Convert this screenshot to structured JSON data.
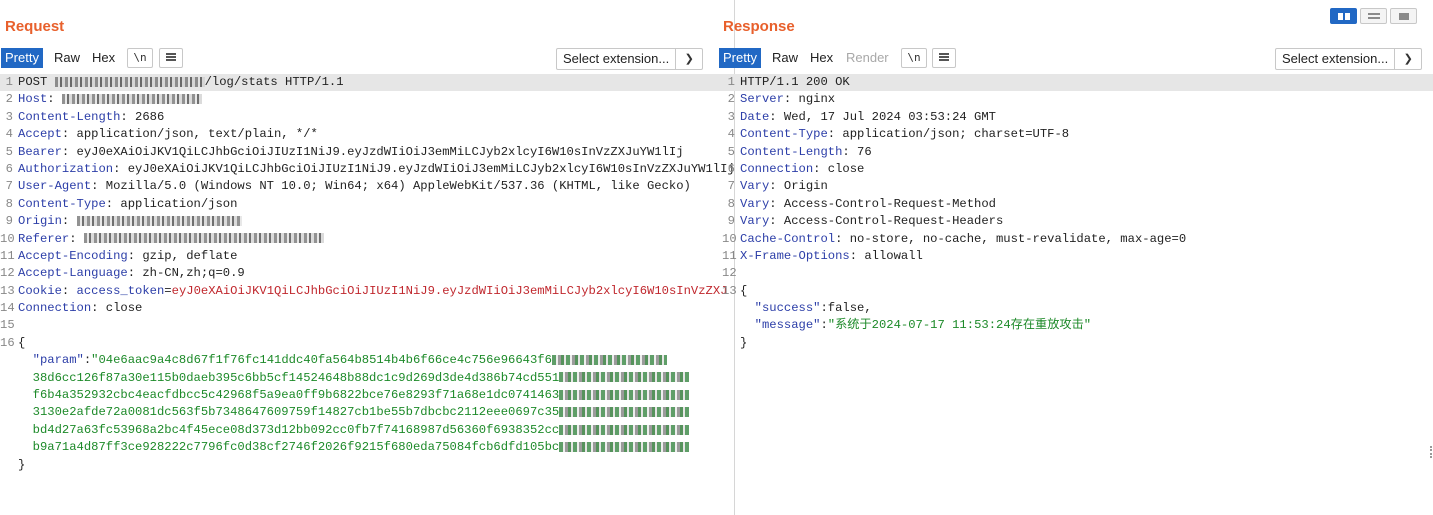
{
  "request": {
    "title": "Request",
    "tabs": [
      "Pretty",
      "Raw",
      "Hex"
    ],
    "newline_btn": "\\n",
    "menu_icon": "menu-icon",
    "select_extension": "Select extension...",
    "lines": [
      {
        "n": "1",
        "parts": [
          {
            "t": "POST ",
            "c": "hv"
          },
          {
            "blur": 150
          },
          {
            "t": "/log/stats HTTP/1.1",
            "c": "hv"
          }
        ]
      },
      {
        "n": "2",
        "parts": [
          {
            "t": "Host",
            "c": "hk"
          },
          {
            "t": ": ",
            "c": "hv"
          },
          {
            "blur": 140
          }
        ]
      },
      {
        "n": "3",
        "parts": [
          {
            "t": "Content-Length",
            "c": "hk"
          },
          {
            "t": ": 2686",
            "c": "hv"
          }
        ]
      },
      {
        "n": "4",
        "parts": [
          {
            "t": "Accept",
            "c": "hk"
          },
          {
            "t": ": application/json, text/plain, */*",
            "c": "hv"
          }
        ]
      },
      {
        "n": "5",
        "parts": [
          {
            "t": "Bearer",
            "c": "hk"
          },
          {
            "t": ": eyJ0eXAiOiJKV1QiLCJhbGciOiJIUzI1NiJ9.eyJzdWIiOiJ3emMiLCJyb2xlcyI6W10sInVzZXJuYW1lIj",
            "c": "hv"
          }
        ]
      },
      {
        "n": "6",
        "parts": [
          {
            "t": "Authorization",
            "c": "hk"
          },
          {
            "t": ": eyJ0eXAiOiJKV1QiLCJhbGciOiJIUzI1NiJ9.eyJzdWIiOiJ3emMiLCJyb2xlcyI6W10sInVzZXJuYW1lIj",
            "c": "hv"
          }
        ]
      },
      {
        "n": "7",
        "parts": [
          {
            "t": "User-Agent",
            "c": "hk"
          },
          {
            "t": ": Mozilla/5.0 (Windows NT 10.0; Win64; x64) AppleWebKit/537.36 (KHTML, like Gecko)",
            "c": "hv"
          }
        ]
      },
      {
        "n": "8",
        "parts": [
          {
            "t": "Content-Type",
            "c": "hk"
          },
          {
            "t": ": application/json",
            "c": "hv"
          }
        ]
      },
      {
        "n": "9",
        "parts": [
          {
            "t": "Origin",
            "c": "hk"
          },
          {
            "t": ": ",
            "c": "hv"
          },
          {
            "blur": 165
          }
        ]
      },
      {
        "n": "10",
        "parts": [
          {
            "t": "Referer",
            "c": "hk"
          },
          {
            "t": ": ",
            "c": "hv"
          },
          {
            "blur": 240
          }
        ]
      },
      {
        "n": "11",
        "parts": [
          {
            "t": "Accept-Encoding",
            "c": "hk"
          },
          {
            "t": ": gzip, deflate",
            "c": "hv"
          }
        ]
      },
      {
        "n": "12",
        "parts": [
          {
            "t": "Accept-Language",
            "c": "hk"
          },
          {
            "t": ": zh-CN,zh;q=0.9",
            "c": "hv"
          }
        ]
      },
      {
        "n": "13",
        "parts": [
          {
            "t": "Cookie",
            "c": "hk"
          },
          {
            "t": ": ",
            "c": "hv"
          },
          {
            "t": "access_token",
            "c": "ck"
          },
          {
            "t": "=",
            "c": "hv"
          },
          {
            "t": "eyJ0eXAiOiJKV1QiLCJhbGciOiJIUzI1NiJ9.eyJzdWIiOiJ3emMiLCJyb2xlcyI6W10sInVzZXJ",
            "c": "cv"
          }
        ]
      },
      {
        "n": "14",
        "parts": [
          {
            "t": "Connection",
            "c": "hk"
          },
          {
            "t": ": close",
            "c": "hv"
          }
        ]
      },
      {
        "n": "15",
        "parts": []
      },
      {
        "n": "16",
        "parts": [
          {
            "t": "{",
            "c": "jp"
          }
        ]
      },
      {
        "n": "",
        "parts": [
          {
            "t": "  ",
            "c": "jp"
          },
          {
            "t": "\"param\"",
            "c": "jk"
          },
          {
            "t": ":",
            "c": "jp"
          },
          {
            "t": "\"04e6aac9a4c8d67f1f76fc141ddc40fa564b8514b4b6f66ce4c756e96643f6",
            "c": "js"
          },
          {
            "blur": 115,
            "green": true
          }
        ]
      },
      {
        "n": "",
        "parts": [
          {
            "t": "  38d6cc126f87a30e115b0daeb395c6bb5cf14524648b88dc1c9d269d3de4d386b74cd551",
            "c": "js"
          },
          {
            "blur": 130,
            "green": true
          }
        ]
      },
      {
        "n": "",
        "parts": [
          {
            "t": "  f6b4a352932cbc4eacfdbcc5c42968f5a9ea0ff9b6822bce76e8293f71a68e1dc0741463",
            "c": "js"
          },
          {
            "blur": 130,
            "green": true
          }
        ]
      },
      {
        "n": "",
        "parts": [
          {
            "t": "  3130e2afde72a0081dc563f5b7348647609759f14827cb1be55b7dbcbc2112eee0697c35",
            "c": "js"
          },
          {
            "blur": 130,
            "green": true
          }
        ]
      },
      {
        "n": "",
        "parts": [
          {
            "t": "  bd4d27a63fc53968a2bc4f45ece08d373d12bb092cc0fb7f74168987d56360f6938352cc",
            "c": "js"
          },
          {
            "blur": 130,
            "green": true
          }
        ]
      },
      {
        "n": "",
        "parts": [
          {
            "t": "  b9a71a4d87ff3ce928222c7796fc0d38cf2746f2026f9215f680eda75084fcb6dfd105bc",
            "c": "js"
          },
          {
            "blur": 130,
            "green": true
          }
        ]
      },
      {
        "n": "",
        "parts": [
          {
            "t": "}",
            "c": "jp"
          }
        ]
      }
    ]
  },
  "response": {
    "title": "Response",
    "tabs": [
      "Pretty",
      "Raw",
      "Hex",
      "Render"
    ],
    "newline_btn": "\\n",
    "menu_icon": "menu-icon",
    "select_extension": "Select extension...",
    "lines": [
      {
        "n": "1",
        "parts": [
          {
            "t": "HTTP/1.1 200 OK",
            "c": "hv"
          }
        ]
      },
      {
        "n": "2",
        "parts": [
          {
            "t": "Server",
            "c": "hk"
          },
          {
            "t": ": nginx",
            "c": "hv"
          }
        ]
      },
      {
        "n": "3",
        "parts": [
          {
            "t": "Date",
            "c": "hk"
          },
          {
            "t": ": Wed, 17 Jul 2024 03:53:24 GMT",
            "c": "hv"
          }
        ]
      },
      {
        "n": "4",
        "parts": [
          {
            "t": "Content-Type",
            "c": "hk"
          },
          {
            "t": ": application/json; charset=UTF-8",
            "c": "hv"
          }
        ]
      },
      {
        "n": "5",
        "parts": [
          {
            "t": "Content-Length",
            "c": "hk"
          },
          {
            "t": ": 76",
            "c": "hv"
          }
        ]
      },
      {
        "n": "6",
        "parts": [
          {
            "t": "Connection",
            "c": "hk"
          },
          {
            "t": ": close",
            "c": "hv"
          }
        ]
      },
      {
        "n": "7",
        "parts": [
          {
            "t": "Vary",
            "c": "hk"
          },
          {
            "t": ": Origin",
            "c": "hv"
          }
        ]
      },
      {
        "n": "8",
        "parts": [
          {
            "t": "Vary",
            "c": "hk"
          },
          {
            "t": ": Access-Control-Request-Method",
            "c": "hv"
          }
        ]
      },
      {
        "n": "9",
        "parts": [
          {
            "t": "Vary",
            "c": "hk"
          },
          {
            "t": ": Access-Control-Request-Headers",
            "c": "hv"
          }
        ]
      },
      {
        "n": "10",
        "parts": [
          {
            "t": "Cache-Control",
            "c": "hk"
          },
          {
            "t": ": no-store, no-cache, must-revalidate, max-age=0",
            "c": "hv"
          }
        ]
      },
      {
        "n": "11",
        "parts": [
          {
            "t": "X-Frame-Options",
            "c": "hk"
          },
          {
            "t": ": allowall",
            "c": "hv"
          }
        ]
      },
      {
        "n": "12",
        "parts": []
      },
      {
        "n": "13",
        "parts": [
          {
            "t": "{",
            "c": "jp"
          }
        ]
      },
      {
        "n": "",
        "parts": [
          {
            "t": "  ",
            "c": "jp"
          },
          {
            "t": "\"success\"",
            "c": "jk"
          },
          {
            "t": ":false,",
            "c": "jp"
          }
        ]
      },
      {
        "n": "",
        "parts": [
          {
            "t": "  ",
            "c": "jp"
          },
          {
            "t": "\"message\"",
            "c": "jk"
          },
          {
            "t": ":",
            "c": "jp"
          },
          {
            "t": "\"系统于2024-07-17 11:53:24存在重放攻击\"",
            "c": "js"
          }
        ]
      },
      {
        "n": "",
        "parts": [
          {
            "t": "}",
            "c": "jp"
          }
        ]
      }
    ]
  },
  "layout_toggles": [
    "split-horizontal-icon",
    "split-vertical-icon",
    "tabs-layout-icon"
  ],
  "colors": {
    "accent": "#2168c4",
    "title": "#e8602c",
    "header_key": "#2c3ea8",
    "cookie_value": "#c0272d",
    "json_string": "#1d8a29"
  }
}
